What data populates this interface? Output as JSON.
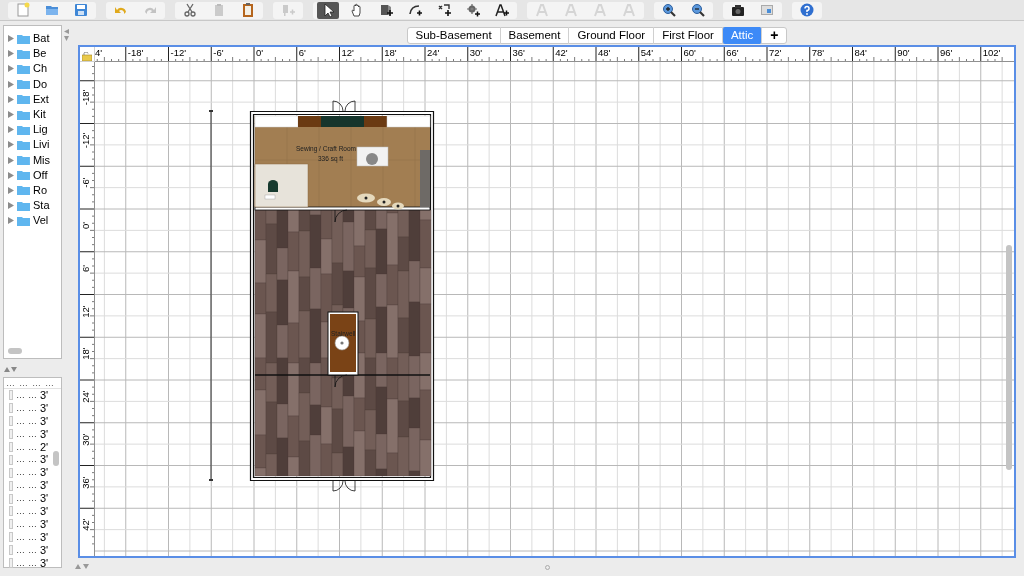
{
  "toolbar": [
    [
      {
        "kind": "new",
        "disabled": false
      },
      {
        "kind": "open",
        "disabled": false
      },
      {
        "kind": "save",
        "disabled": false
      }
    ],
    [
      {
        "kind": "undo",
        "disabled": false
      },
      {
        "kind": "redo",
        "disabled": true
      }
    ],
    [
      {
        "kind": "cut",
        "disabled": false
      },
      {
        "kind": "copy",
        "disabled": true
      },
      {
        "kind": "paste",
        "disabled": false
      }
    ],
    [
      {
        "kind": "add-furniture",
        "disabled": true
      }
    ],
    [
      {
        "kind": "select",
        "selected": true
      },
      {
        "kind": "pan",
        "selected": false
      },
      {
        "kind": "room",
        "selected": false
      },
      {
        "kind": "polyline",
        "selected": false
      },
      {
        "kind": "dimension",
        "selected": false
      },
      {
        "kind": "compass",
        "selected": false
      },
      {
        "kind": "text",
        "selected": false
      }
    ],
    [
      {
        "kind": "text-style",
        "disabled": true
      },
      {
        "kind": "text-style",
        "disabled": true
      },
      {
        "kind": "text-style",
        "disabled": true
      },
      {
        "kind": "text-style",
        "disabled": true
      }
    ],
    [
      {
        "kind": "zoom-in",
        "disabled": false
      },
      {
        "kind": "zoom-out",
        "disabled": false
      }
    ],
    [
      {
        "kind": "camera",
        "disabled": false
      },
      {
        "kind": "view-3d",
        "disabled": false
      }
    ],
    [
      {
        "kind": "help",
        "disabled": false
      }
    ]
  ],
  "catalog": {
    "categories": [
      {
        "label": "Bat",
        "expanded": false
      },
      {
        "label": "Be",
        "expanded": false
      },
      {
        "label": "Ch",
        "expanded": false
      },
      {
        "label": "Do",
        "expanded": false
      },
      {
        "label": "Ext",
        "expanded": false
      },
      {
        "label": "Kit",
        "expanded": false
      },
      {
        "label": "Lig",
        "expanded": false
      },
      {
        "label": "Livi",
        "expanded": false
      },
      {
        "label": "Mis",
        "expanded": false
      },
      {
        "label": "Off",
        "expanded": false
      },
      {
        "label": "Ro",
        "expanded": false
      },
      {
        "label": "Sta",
        "expanded": false
      },
      {
        "label": "Vel",
        "expanded": false
      }
    ]
  },
  "furniture": {
    "columns": [
      "…",
      "…",
      "…",
      "…"
    ],
    "rows": [
      [
        "…",
        "…",
        "3'"
      ],
      [
        "…",
        "…",
        "3'"
      ],
      [
        "…",
        "…",
        "3'"
      ],
      [
        "…",
        "…",
        "3'"
      ],
      [
        "…",
        "…",
        "2'"
      ],
      [
        "…",
        "…",
        "3'"
      ],
      [
        "…",
        "…",
        "3'"
      ],
      [
        "…",
        "…",
        "3'"
      ],
      [
        "…",
        "…",
        "3'"
      ],
      [
        "…",
        "…",
        "3'"
      ],
      [
        "…",
        "…",
        "3'"
      ],
      [
        "…",
        "…",
        "3'"
      ],
      [
        "…",
        "…",
        "3'"
      ],
      [
        "…",
        "…",
        "3'"
      ]
    ]
  },
  "levels": {
    "tabs": [
      {
        "label": "Sub-Basement",
        "selected": false
      },
      {
        "label": "Basement",
        "selected": false
      },
      {
        "label": "Ground Floor",
        "selected": false
      },
      {
        "label": "First Floor",
        "selected": false
      },
      {
        "label": "Attic",
        "selected": true
      }
    ],
    "add_level": "+"
  },
  "plan": {
    "ruler_x": [
      "4'",
      "-18'",
      "-12'",
      "-6'",
      "0'",
      "6'",
      "12'",
      "18'",
      "24'",
      "30'",
      "36'",
      "42'",
      "48'",
      "54'",
      "60'",
      "66'",
      "72'",
      "78'",
      "84'",
      "90'",
      "96'",
      "102'"
    ],
    "ruler_y": [
      "-18'",
      "-12'",
      "-6'",
      "0'",
      "6'",
      "12'",
      "18'",
      "24'",
      "30'",
      "36'",
      "42'"
    ],
    "rooms": [
      {
        "name": "Sewing / Craft Room",
        "area": "336 sq ft"
      },
      {
        "name": "Stairwell"
      }
    ]
  }
}
